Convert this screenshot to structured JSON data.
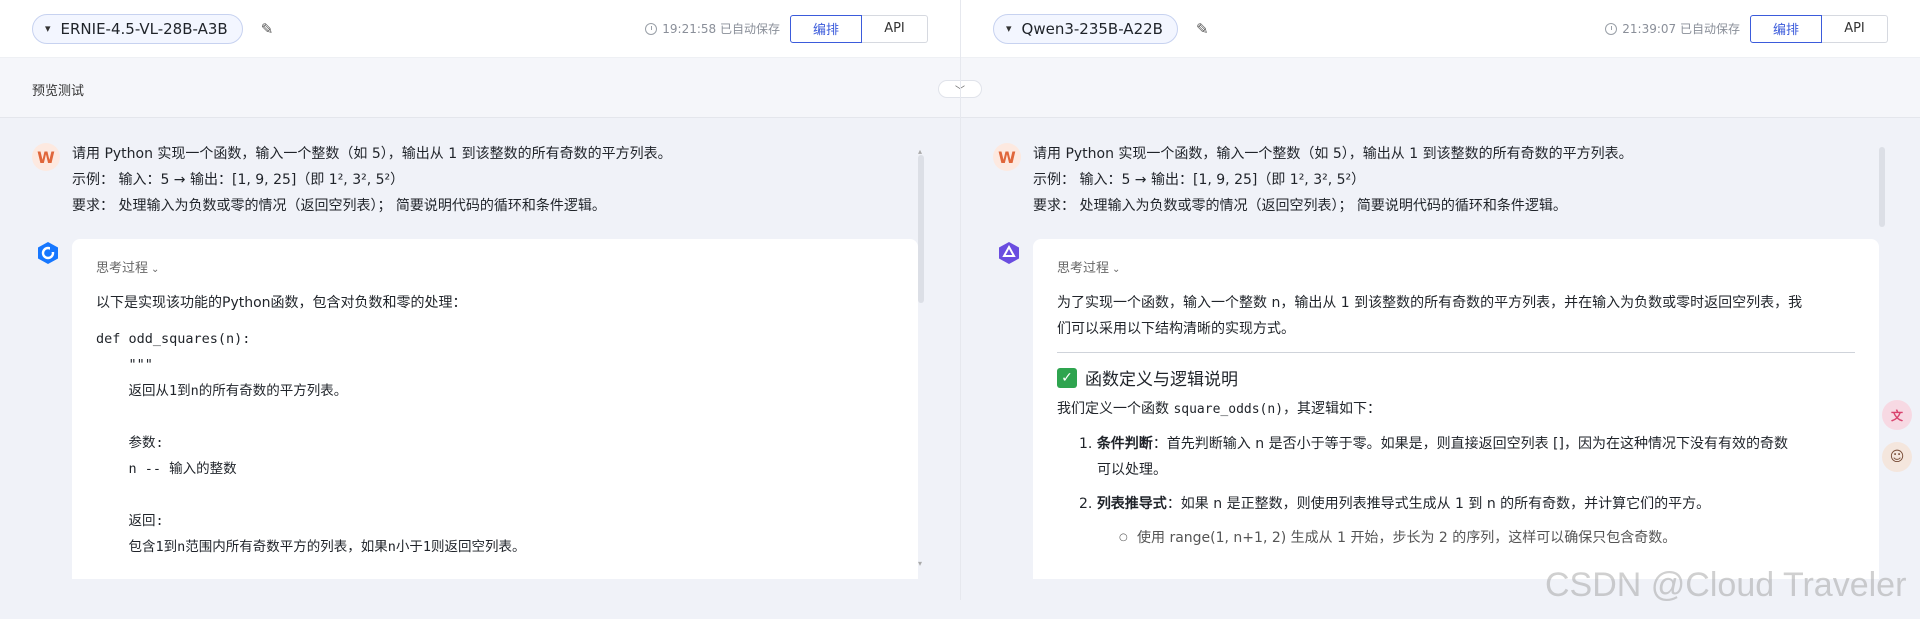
{
  "left": {
    "model_name": "ERNIE-4.5-VL-28B-A3B",
    "save_time": "19:21:58 已自动保存",
    "arrange_label": "编排",
    "api_label": "API",
    "avatar_letter": "W",
    "user_lines": [
      "请用 Python 实现一个函数，输入一个整数（如 5），输出从 1 到该整数的所有奇数的平方列表。",
      "示例： 输入：5 → 输出：[1, 9, 25]（即 1², 3², 5²）",
      "要求： 处理输入为负数或零的情况（返回空列表）； 简要说明代码的循环和条件逻辑。"
    ],
    "think_label": "思考过程",
    "intro": "以下是实现该功能的Python函数，包含对负数和零的处理：",
    "code_lines": [
      "def odd_squares(n):",
      "    \"\"\"",
      "    返回从1到n的所有奇数的平方列表。",
      "",
      "    参数:",
      "    n -- 输入的整数",
      "",
      "    返回:",
      "    包含1到n范围内所有奇数平方的列表，如果n小于1则返回空列表。"
    ]
  },
  "right": {
    "model_name": "Qwen3-235B-A22B",
    "save_time": "21:39:07 已自动保存",
    "arrange_label": "编排",
    "api_label": "API",
    "avatar_letter": "W",
    "user_lines": [
      "请用 Python 实现一个函数，输入一个整数（如 5），输出从 1 到该整数的所有奇数的平方列表。",
      "示例： 输入：5 → 输出：[1, 9, 25]（即 1², 3², 5²）",
      "要求： 处理输入为负数或零的情况（返回空列表）； 简要说明代码的循环和条件逻辑。"
    ],
    "think_label": "思考过程",
    "intro_1": "为了实现一个函数，输入一个整数 n，输出从 1 到该整数的所有奇数的平方列表，并在输入为负数或零时返回空列表，我",
    "intro_2": "们可以采用以下结构清晰的实现方式。",
    "section_title": "函数定义与逻辑说明",
    "define_text_pre": "我们定义一个函数 ",
    "define_code": "square_odds(n)",
    "define_text_post": "，其逻辑如下：",
    "items": [
      {
        "num": "1.",
        "bold": "条件判断",
        "text_1": "：首先判断输入 n 是否小于等于零。如果是，则直接返回空列表 []，因为在这种情况下没有有效的奇数",
        "text_2": "可以处理。"
      },
      {
        "num": "2.",
        "bold": "列表推导式",
        "text_1": "：如果 n 是正整数，则使用列表推导式生成从 1 到 n 的所有奇数，并计算它们的平方。",
        "text_2": ""
      }
    ],
    "sub_item": "使用 range(1, n+1, 2) 生成从 1 开始，步长为 2 的序列，这样可以确保只包含奇数。"
  },
  "preview_title": "预览测试",
  "watermark": "CSDN @Cloud Traveler",
  "colors": {
    "accent": "#3b5bdb",
    "ernie": "#1677ff",
    "qwen": "#6a4de0"
  }
}
